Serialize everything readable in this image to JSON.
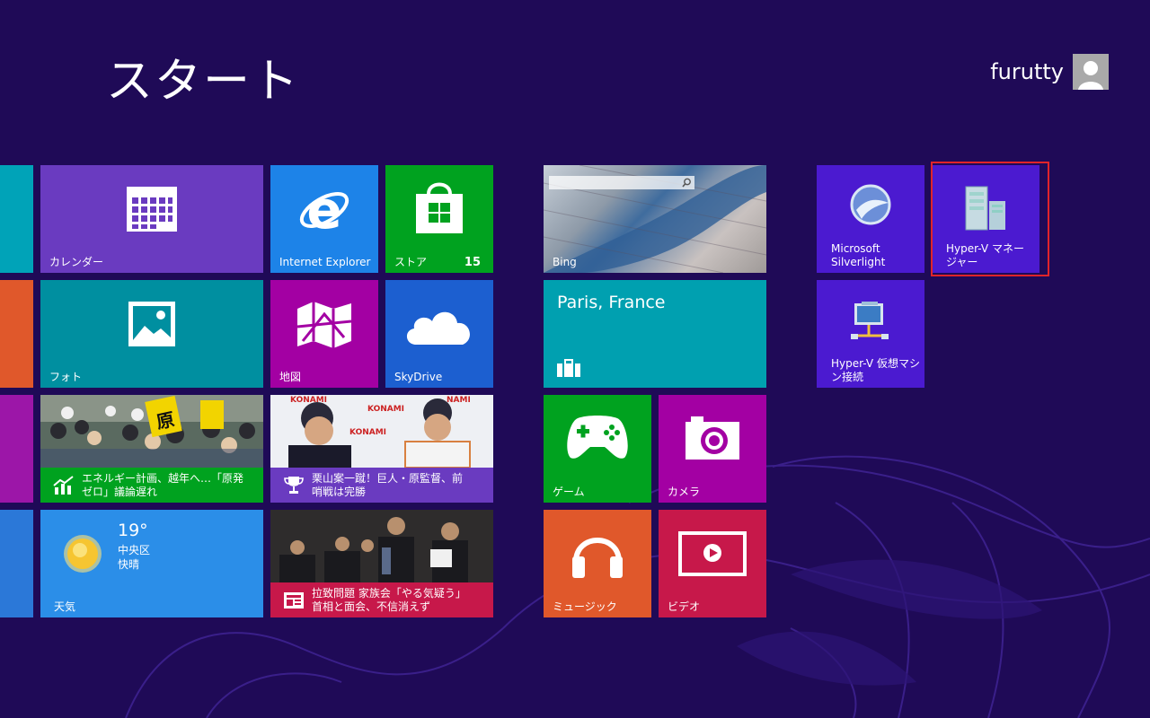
{
  "header": {
    "title": "スタート",
    "user_name": "furutty"
  },
  "tiles": {
    "calendar": {
      "label": "カレンダー"
    },
    "ie": {
      "label": "Internet Explorer"
    },
    "store": {
      "label": "ストア",
      "badge": "15"
    },
    "bing": {
      "label": "Bing"
    },
    "silverlight": {
      "label": "Microsoft\nSilverlight"
    },
    "hyperv_manager": {
      "label": "Hyper-V マネー\nジャー"
    },
    "photos": {
      "label": "フォト"
    },
    "maps": {
      "label": "地図"
    },
    "skydrive": {
      "label": "SkyDrive"
    },
    "travel": {
      "label": "Paris, France"
    },
    "hyperv_connect": {
      "label": "Hyper-V 仮想マシ\nン接続"
    },
    "finance_news": {
      "label": "エネルギー計画、越年へ…「原発\nゼロ」議論遅れ"
    },
    "sports_news": {
      "label": "栗山案一蹴！巨人・原監督、前\n哨戦は完勝"
    },
    "games": {
      "label": "ゲーム"
    },
    "camera": {
      "label": "カメラ"
    },
    "weather": {
      "temp": "19°",
      "location": "中央区",
      "condition": "快晴",
      "label": "天気"
    },
    "news": {
      "label": "拉致問題 家族会「やる気疑う」\n首相と面会、不信消えず"
    },
    "music": {
      "label": "ミュージック"
    },
    "video": {
      "label": "ビデオ"
    }
  },
  "colors": {
    "background": "#1f0a57",
    "selection": "#e0242a"
  }
}
